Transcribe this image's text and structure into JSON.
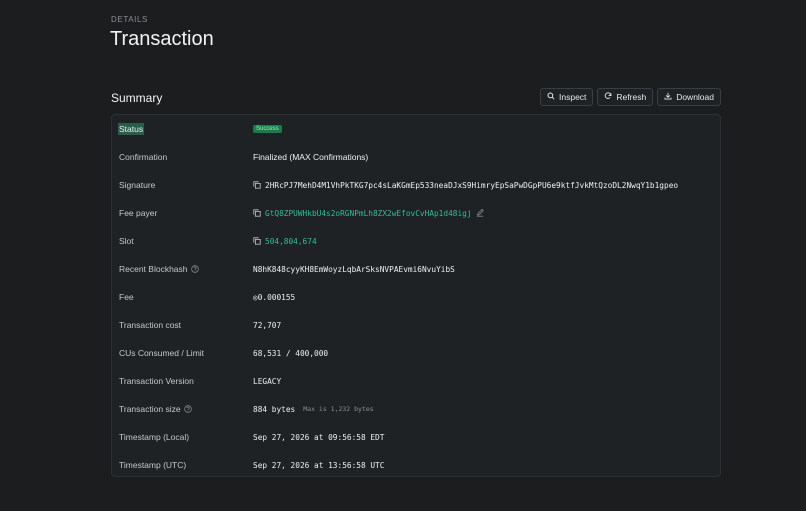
{
  "header": {
    "eyebrow": "DETAILS",
    "title": "Transaction"
  },
  "summary": {
    "title": "Summary",
    "actions": {
      "inspect": "Inspect",
      "refresh": "Refresh",
      "download": "Download"
    }
  },
  "rows": {
    "status": {
      "label": "Status",
      "badge": "Success"
    },
    "confirmation": {
      "label": "Confirmation",
      "value": "Finalized (MAX Confirmations)"
    },
    "signature": {
      "label": "Signature",
      "value": "2HRcPJ7MehD4M1VhPkTKG7pc4sLaKGmEp533neaDJxS9HimryEpSaPwDGpPU6e9ktfJvkMtQzoDL2NwqY1b1gpeo"
    },
    "fee_payer": {
      "label": "Fee payer",
      "value": "GtQ8ZPUWHkbU4s2oRGNPmLh8ZX2wEfovCvHAp1d48igj"
    },
    "slot": {
      "label": "Slot",
      "value": "504,804,674"
    },
    "recent_blockhash": {
      "label": "Recent Blockhash",
      "value": "N8hK848cyyKH8EmWoyzLqbArSksNVPAEvmi6NvuYibS"
    },
    "fee": {
      "label": "Fee",
      "value": "◎0.000155"
    },
    "transaction_cost": {
      "label": "Transaction cost",
      "value": "72,707"
    },
    "cus": {
      "label": "CUs Consumed / Limit",
      "value": "68,531 / 400,000"
    },
    "version": {
      "label": "Transaction Version",
      "value": "LEGACY"
    },
    "size": {
      "label": "Transaction size",
      "value": "884 bytes",
      "note": "Max is 1,232 bytes"
    },
    "ts_local": {
      "label": "Timestamp (Local)",
      "value": "Sep 27, 2026 at 09:56:58 EDT"
    },
    "ts_utc": {
      "label": "Timestamp (UTC)",
      "value": "Sep 27, 2026 at 13:56:58 UTC"
    }
  },
  "colors": {
    "accent": "#2fbf9a",
    "badge_bg": "#1e7a4c",
    "background": "#1b1d1e"
  },
  "icons": [
    "search-icon",
    "refresh-icon",
    "download-icon",
    "copy-icon",
    "edit-icon",
    "help-icon"
  ]
}
